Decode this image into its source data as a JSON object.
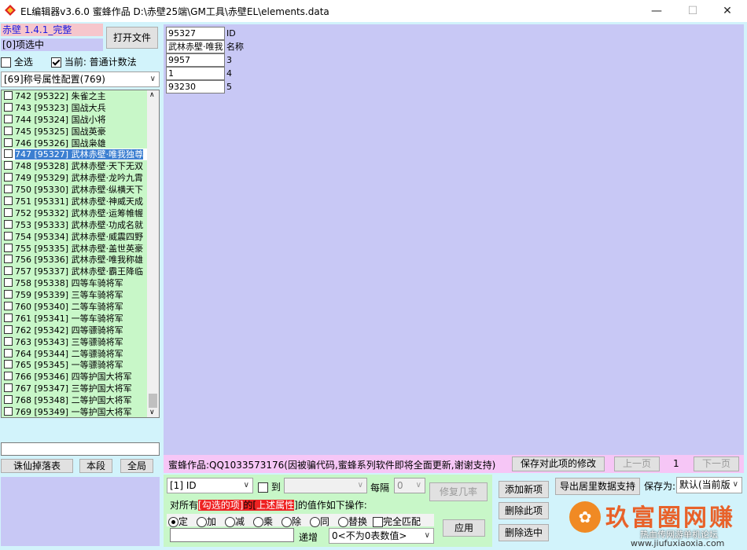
{
  "window": {
    "title": "EL编辑器v3.6.0    蜜蜂作品   D:\\赤壁25端\\GM工具\\赤壁EL\\elements.data"
  },
  "left": {
    "version_label": "赤壁 1.4.1_完整",
    "selected_count": "[0]项选中",
    "open_file": "打开文件",
    "select_all": "全选",
    "current_label": "当前: 普通计数法",
    "config_select": "[69]称号属性配置(769)",
    "items": [
      "742  [95322] 朱雀之主",
      "743  [95323] 国战大兵",
      "744  [95324] 国战小将",
      "745  [95325] 国战英豪",
      "746  [95326] 国战枭雄",
      "747  [95327] 武林赤壁·唯我独尊",
      "748  [95328] 武林赤壁·天下无双",
      "749  [95329] 武林赤壁·龙吟九霄",
      "750  [95330] 武林赤壁·纵横天下",
      "751  [95331] 武林赤壁·神威天成",
      "752  [95332] 武林赤壁·运筹帷幄",
      "753  [95333] 武林赤壁·功成名就",
      "754  [95334] 武林赤壁·威震四野",
      "755  [95335] 武林赤壁·盖世英豪",
      "756  [95336] 武林赤壁·唯我称雄",
      "757  [95337] 武林赤壁·霸王降临",
      "758  [95338] 四等车骑将军",
      "759  [95339] 三等车骑将军",
      "760  [95340] 二等车骑将军",
      "761  [95341] 一等车骑将军",
      "762  [95342] 四等骠骑将军",
      "763  [95343] 三等骠骑将军",
      "764  [95344] 二等骠骑将军",
      "765  [95345] 一等骠骑将军",
      "766  [95346] 四等护国大将军",
      "767  [95347] 三等护国大将军",
      "768  [95348] 二等护国大将军",
      "769  [95349] 一等护国大将军"
    ],
    "search_value": "",
    "btn_drop": "诛仙掉落表",
    "btn_section": "本段",
    "btn_global": "全局"
  },
  "fields": [
    {
      "value": "95327",
      "label": "ID"
    },
    {
      "value": "武林赤壁·唯我",
      "label": "名称"
    },
    {
      "value": "9957",
      "label": "3"
    },
    {
      "value": "1",
      "label": "4"
    },
    {
      "value": "93230",
      "label": "5"
    }
  ],
  "status": {
    "message": "蜜蜂作品:QQ1033573176(因被骗代码,蜜蜂系列软件即将全面更新,谢谢支持)",
    "save_changes": "保存对此项的修改",
    "prev_page": "上一页",
    "page_num": "1",
    "next_page": "下一页"
  },
  "ops": {
    "field_select": "[1] ID",
    "to_label": "到",
    "interval_label": "每隔",
    "interval_value": "0",
    "repair": "修复几率",
    "instruction_pre": "对所有",
    "instruction_red1": "[勾选的项]",
    "instruction_mid": "的[",
    "instruction_red2": "上述属性",
    "instruction_post": "]的值作如下操作:",
    "radios": [
      "定",
      "加",
      "减",
      "乘",
      "除",
      "同",
      "替换"
    ],
    "exact_match": "完全匹配",
    "apply": "应用",
    "increment_label": "递增",
    "increment_select": "0<不为0表数值>",
    "add_new": "添加新项",
    "delete_this": "删除此项",
    "delete_selected": "删除选中",
    "export_support": "导出居里数据支持",
    "save_as_label": "保存为:",
    "save_as_value": "默认(当前版"
  },
  "watermark": {
    "title": "玖富圈网赚",
    "subtitle": "热血传网游单机论坛",
    "url": "www.jiufuxiaoxia.com"
  },
  "colors": {
    "accent_selected": "#3c7fd1",
    "list_bg": "#c8f7c8",
    "grid_bg": "#c8c8f5",
    "status_bg": "#f6c6f6",
    "window_bg": "#d2f3fb"
  }
}
